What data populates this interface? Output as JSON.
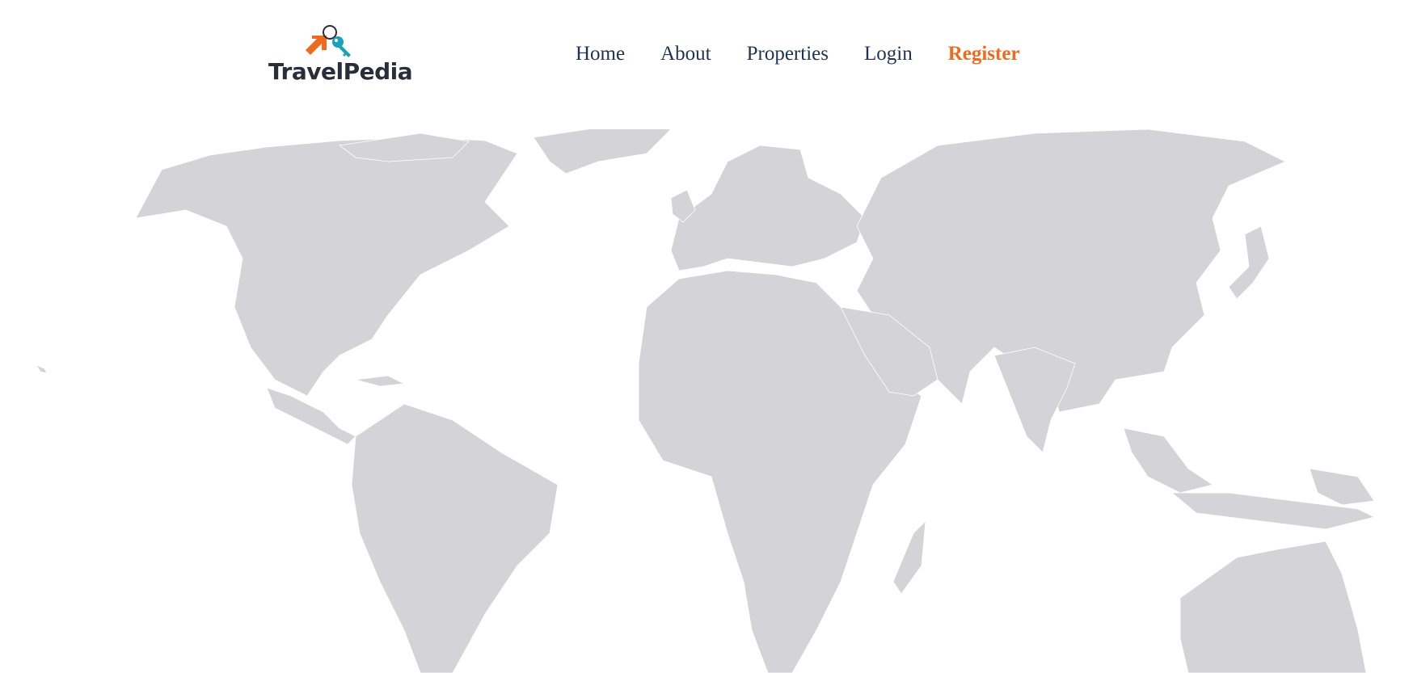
{
  "brand": {
    "name": "TravelPedia"
  },
  "nav": {
    "items": [
      {
        "label": "Home"
      },
      {
        "label": "About"
      },
      {
        "label": "Properties"
      },
      {
        "label": "Login"
      },
      {
        "label": "Register",
        "active": true
      }
    ]
  },
  "colors": {
    "accent": "#ee6a1c",
    "nav_text": "#1f3350",
    "land": "#d4d4d8",
    "key": "#1aa3b8"
  },
  "icons": {
    "logo": "house-key-icon"
  }
}
